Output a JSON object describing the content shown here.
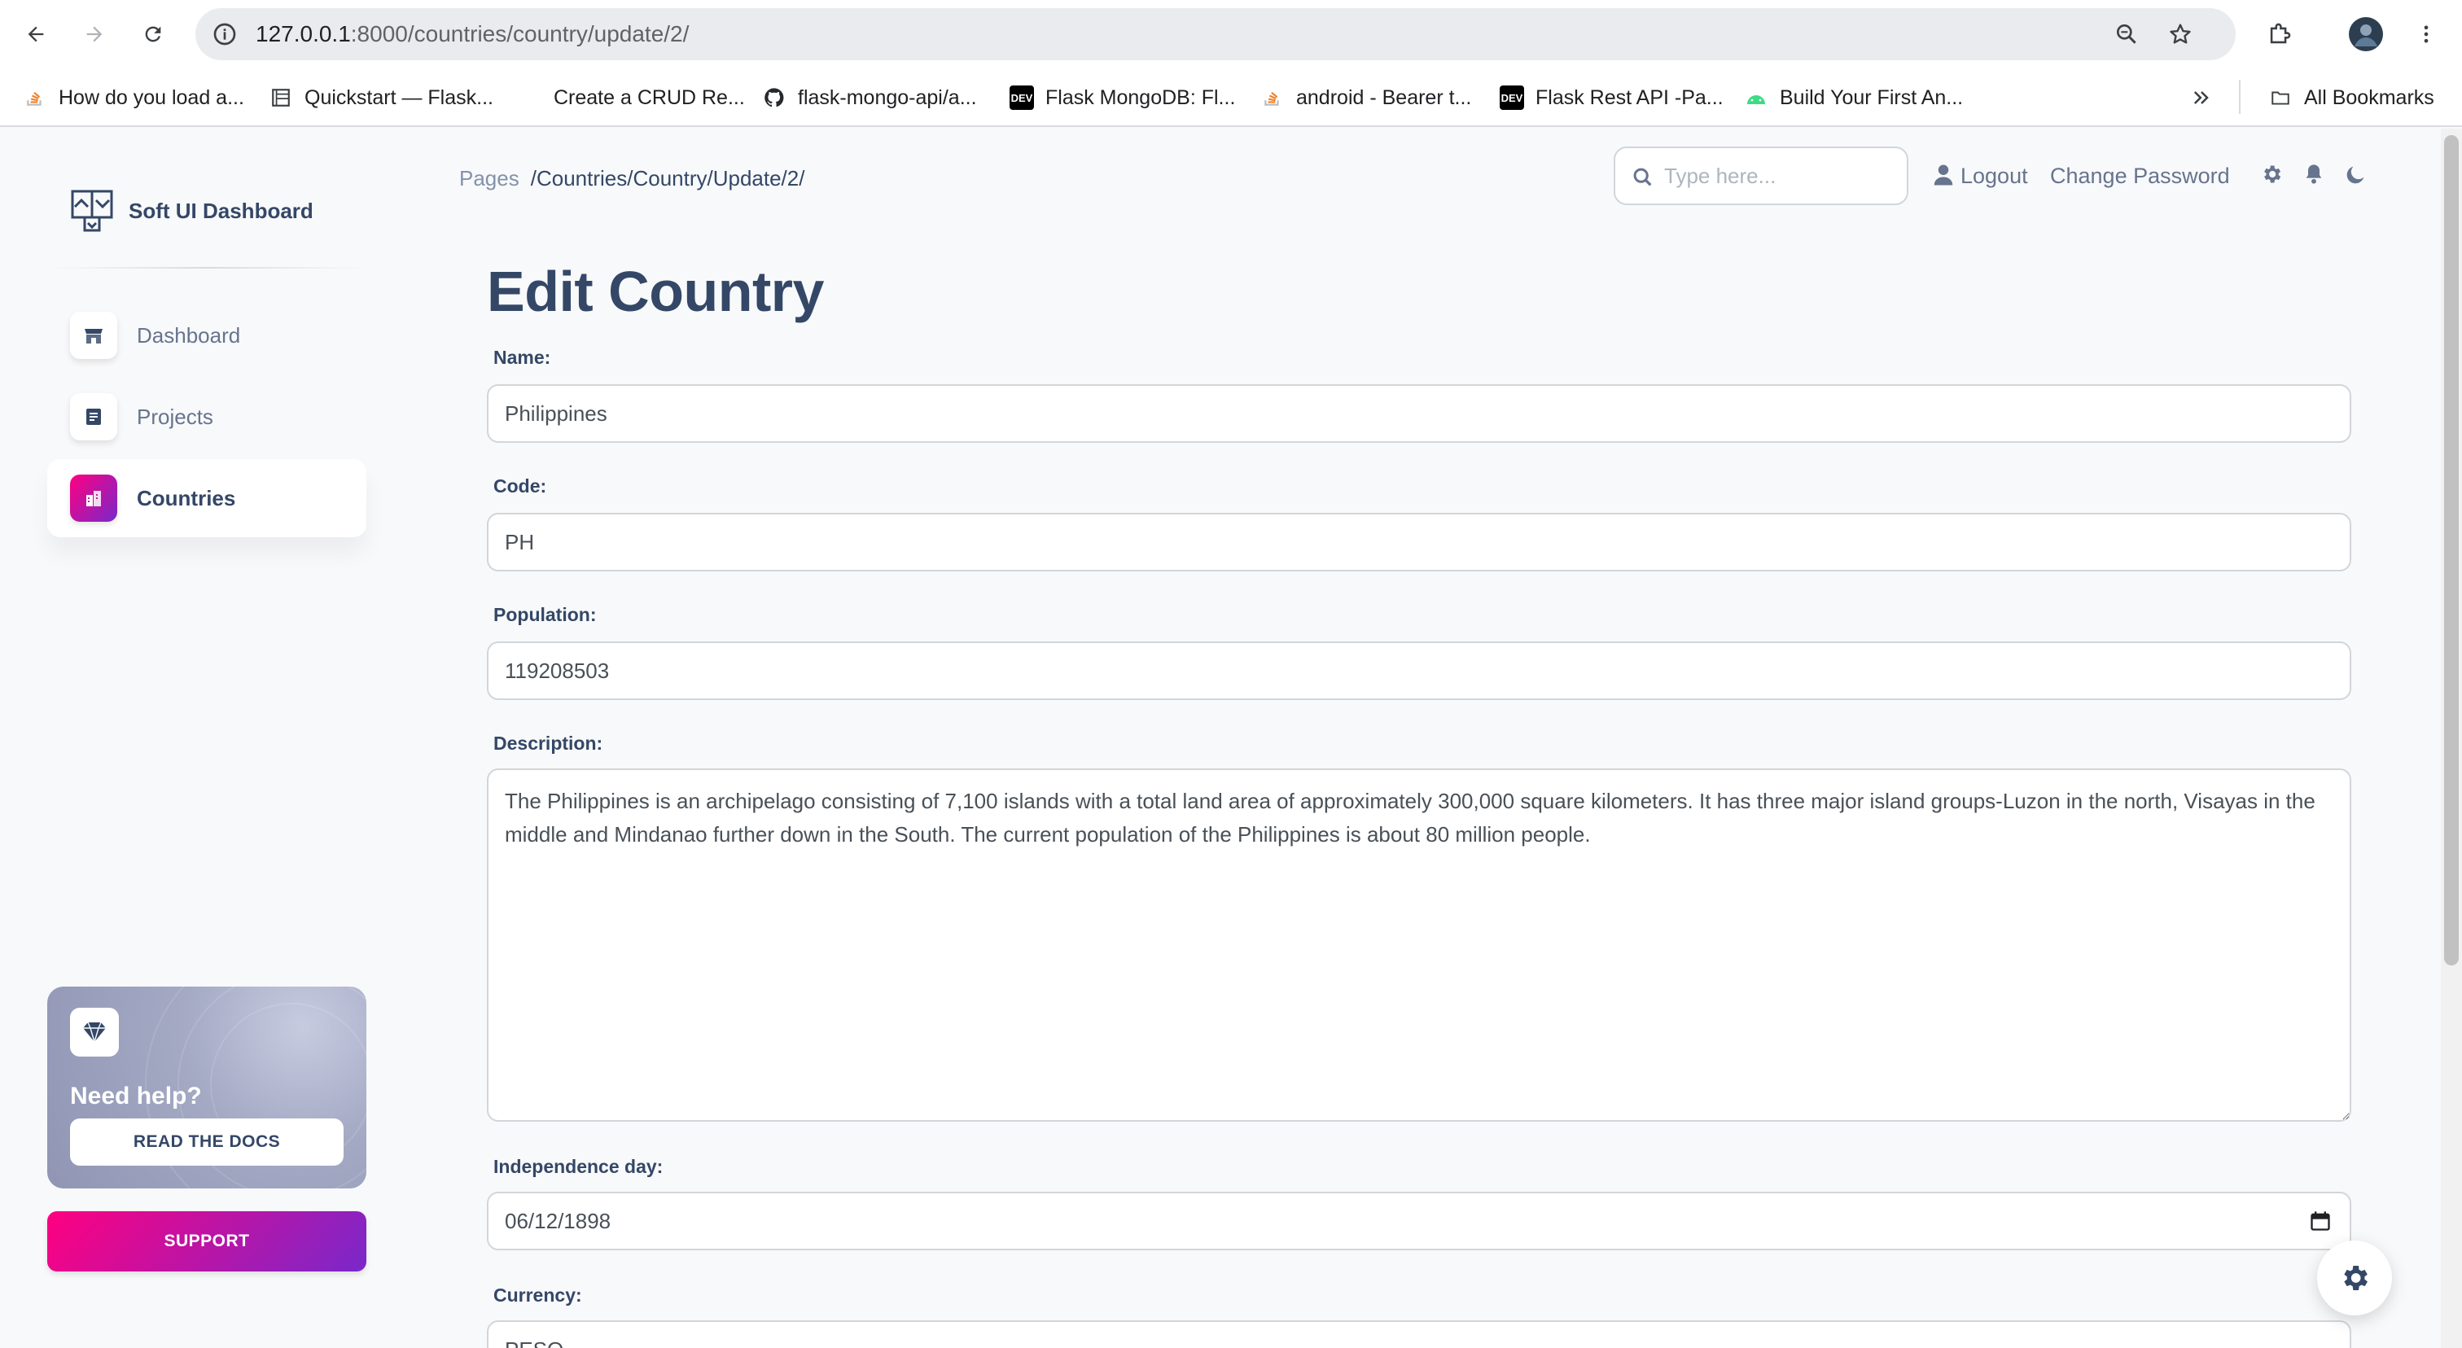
{
  "browser": {
    "url_host": "127.0.0.1",
    "url_path": ":8000/countries/country/update/2/",
    "bookmarks": [
      {
        "label": "How do you load a...",
        "icon": "stackoverflow-icon"
      },
      {
        "label": "Quickstart — Flask...",
        "icon": "docs-icon"
      },
      {
        "label": "Create a CRUD Re...",
        "icon": "blank-icon"
      },
      {
        "label": "flask-mongo-api/a...",
        "icon": "github-icon"
      },
      {
        "label": "Flask MongoDB: Fl...",
        "icon": "dev-icon"
      },
      {
        "label": "android - Bearer t...",
        "icon": "stackoverflow-icon"
      },
      {
        "label": "Flask Rest API -Pa...",
        "icon": "dev-icon"
      },
      {
        "label": "Build Your First An...",
        "icon": "android-icon"
      }
    ],
    "all_bookmarks_label": "All Bookmarks",
    "dev_badge": "DEV"
  },
  "sidebar": {
    "brand": "Soft UI Dashboard",
    "items": [
      {
        "label": "Dashboard",
        "icon": "shop-icon",
        "active": false
      },
      {
        "label": "Projects",
        "icon": "document-icon",
        "active": false
      },
      {
        "label": "Countries",
        "icon": "office-icon",
        "active": true
      }
    ],
    "help": {
      "title": "Need help?",
      "button": "READ THE DOCS",
      "icon": "diamond-icon"
    },
    "support_button": "SUPPORT"
  },
  "navbar": {
    "breadcrumb_root": "Pages",
    "breadcrumb_current": "/Countries/Country/Update/2/",
    "search_placeholder": "Type here...",
    "logout": "Logout",
    "change_password": "Change Password"
  },
  "form": {
    "title": "Edit Country",
    "name_label": "Name:",
    "name_value": "Philippines",
    "code_label": "Code:",
    "code_value": "PH",
    "population_label": "Population:",
    "population_value": "119208503",
    "description_label": "Description:",
    "description_value": "The Philippines is an archipelago consisting of 7,100 islands with a total land area of approximately 300,000 square kilometers. It has three major island groups-Luzon in the north, Visayas in the middle and Mindanao further down in the South. The current population of the Philippines is about 80 million people.",
    "independence_label": "Independence day:",
    "independence_value": "06/12/1898",
    "currency_label": "Currency:",
    "currency_value": "PESO"
  },
  "colors": {
    "primary_gradient_start": "#7928ca",
    "primary_gradient_end": "#ff0080",
    "text_dark": "#344767",
    "text_muted": "#67748e"
  }
}
